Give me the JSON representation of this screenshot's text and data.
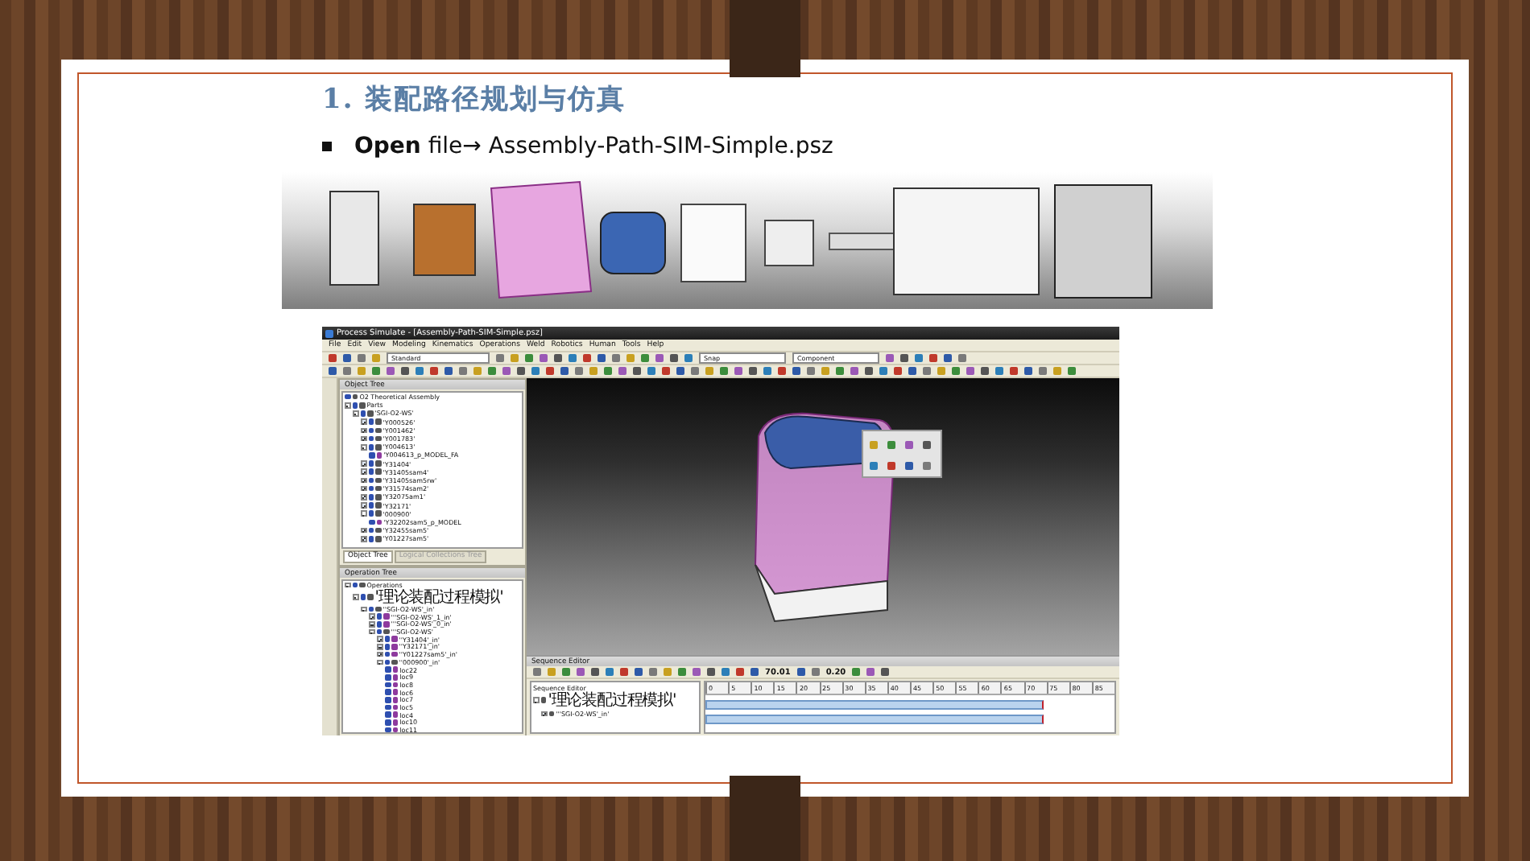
{
  "slide": {
    "title": "1. 装配路径规划与仿真",
    "bullet": "**Open** file→ Assembly-Path-SIM-Simple.psz"
  },
  "app": {
    "window_title": "Process Simulate - [Assembly-Path-SIM-Simple.psz]",
    "menu": [
      "File",
      "Edit",
      "View",
      "Modeling",
      "Kinematics",
      "Operations",
      "Weld",
      "Robotics",
      "Human",
      "Tools",
      "Help"
    ],
    "toolbar_fields": [
      "Standard",
      "Snap",
      "Component"
    ],
    "object_tree": {
      "title": "Object Tree",
      "items": [
        {
          "label": "O2 Theoretical Assembly"
        },
        {
          "label": "Parts",
          "expanded": true,
          "children": [
            {
              "label": "'SGI-O2-WS'",
              "expanded": true,
              "children": [
                {
                  "label": "'Y000526'",
                  "expanded": false
                },
                {
                  "label": "'Y001462'",
                  "expanded": false
                },
                {
                  "label": "'Y001783'",
                  "expanded": false
                },
                {
                  "label": "'Y004613'",
                  "expanded": true,
                  "children": [
                    {
                      "label": "'Y004613_p_MODEL_FA"
                    }
                  ]
                },
                {
                  "label": "'Y31404'",
                  "expanded": false
                },
                {
                  "label": "'Y31405sam4'",
                  "expanded": false
                },
                {
                  "label": "'Y31405sam5rw'",
                  "expanded": false
                },
                {
                  "label": "'Y31574sam2'",
                  "expanded": false
                },
                {
                  "label": "'Y32075am1'",
                  "expanded": false
                },
                {
                  "label": "'Y32171'",
                  "expanded": false
                },
                {
                  "label": "'000900'",
                  "expanded": true,
                  "children": [
                    {
                      "label": "'Y32202sam5_p_MODEL"
                    }
                  ]
                },
                {
                  "label": "'Y32455sam5'",
                  "expanded": false
                },
                {
                  "label": "'Y01227sam5'",
                  "expanded": false
                }
              ]
            }
          ]
        }
      ],
      "tabs": [
        {
          "label": "Object Tree",
          "selected": true
        },
        {
          "label": "Logical Collections Tree",
          "selected": false
        }
      ]
    },
    "operation_tree": {
      "title": "Operation Tree",
      "items": [
        {
          "label": "Operations",
          "expanded": true,
          "children": [
            {
              "label": "'理论装配过程模拟'",
              "expanded": true,
              "children": [
                {
                  "label": "''SGI-O2-WS'_in'",
                  "expanded": true,
                  "children": [
                    {
                      "label": "'''SGI-O2-WS'_1_in'",
                      "expanded": false
                    },
                    {
                      "label": "'''SGI-O2-WS'_0_in'",
                      "expanded": false
                    },
                    {
                      "label": "'''SGI-O2-WS'",
                      "expanded": true,
                      "children": [
                        {
                          "label": "''Y31404'_in'",
                          "expanded": false
                        },
                        {
                          "label": "''Y32171'_in'",
                          "expanded": false
                        },
                        {
                          "label": "''Y01227sam5'_in'",
                          "expanded": false
                        },
                        {
                          "label": "''000900'_in'",
                          "expanded": true,
                          "children": [
                            {
                              "label": "loc22"
                            },
                            {
                              "label": "loc9"
                            },
                            {
                              "label": "loc8"
                            },
                            {
                              "label": "loc6"
                            },
                            {
                              "label": "loc7"
                            },
                            {
                              "label": "loc5"
                            },
                            {
                              "label": "loc4"
                            },
                            {
                              "label": "loc10"
                            },
                            {
                              "label": "loc11"
                            }
                          ]
                        }
                      ]
                    }
                  ]
                }
              ]
            }
          ]
        }
      ]
    },
    "sequence_editor": {
      "title": "Sequence Editor",
      "time": "70.01",
      "speed": "0.20",
      "column": "Sequence Editor",
      "rows": [
        {
          "label": "'理论装配过程模拟'",
          "expanded": true
        },
        {
          "label": "'''SGI-O2-WS'_in'",
          "expanded": false
        }
      ],
      "ticks": [
        "0",
        "5",
        "10",
        "15",
        "20",
        "25",
        "30",
        "35",
        "40",
        "45",
        "50",
        "55",
        "60",
        "65",
        "70",
        "75",
        "80",
        "85"
      ]
    }
  }
}
